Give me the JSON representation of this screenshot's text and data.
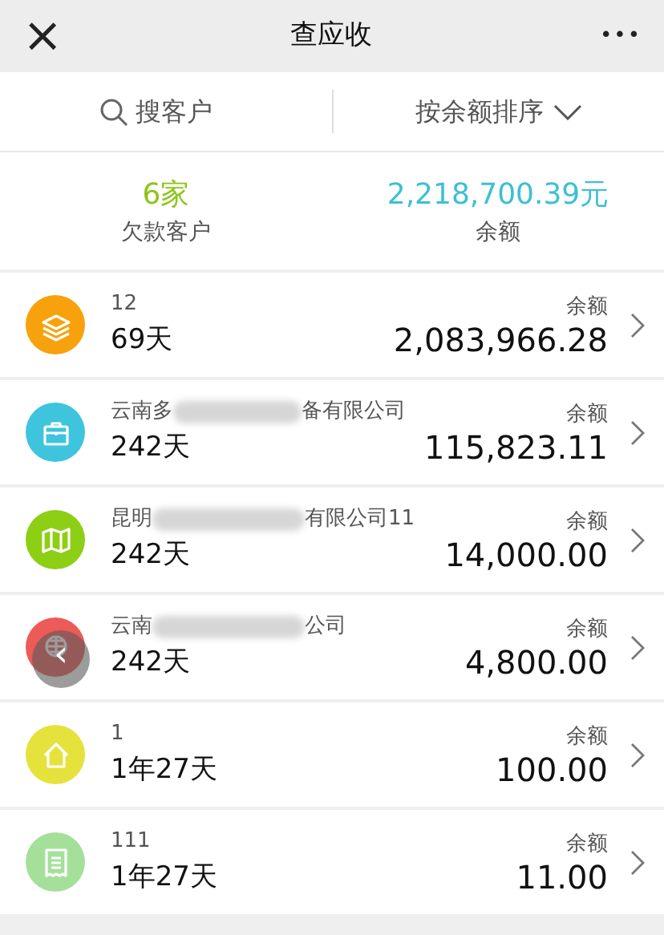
{
  "header": {
    "close": "×",
    "title": "查应收",
    "more": "•••"
  },
  "toolbar": {
    "search_placeholder": "搜客户",
    "sort": "按余额排序"
  },
  "summary": {
    "count": "6家",
    "count_label": "欠款客户",
    "total": "2,218,700.39元",
    "total_label": "余额"
  },
  "customers": [
    {
      "color": "#f7a10c",
      "name_parts": [
        "12"
      ],
      "age": "69天",
      "balance_label": "余额",
      "balance": "2,083,966.28"
    },
    {
      "color": "#3ec4dd",
      "name_parts": [
        "云南多",
        "备有限公司"
      ],
      "age": "242天",
      "balance_label": "余额",
      "balance": "115,823.11"
    },
    {
      "color": "#8dcf15",
      "name_parts": [
        "昆明",
        "有限公司11"
      ],
      "age": "242天",
      "balance_label": "余额",
      "balance": "14,000.00"
    },
    {
      "color": "#ec5b58",
      "name_parts": [
        "云南",
        "公司"
      ],
      "age": "242天",
      "balance_label": "余额",
      "balance": "4,800.00"
    },
    {
      "color": "#e6e23c",
      "name_parts": [
        "1"
      ],
      "age": "1年27天",
      "balance_label": "余额",
      "balance": "100.00"
    },
    {
      "color": "#a5e09b",
      "name_parts": [
        "111"
      ],
      "age": "1年27天",
      "balance_label": "余额",
      "balance": "11.00"
    }
  ],
  "floating_back": {
    "glyph": "‹"
  }
}
